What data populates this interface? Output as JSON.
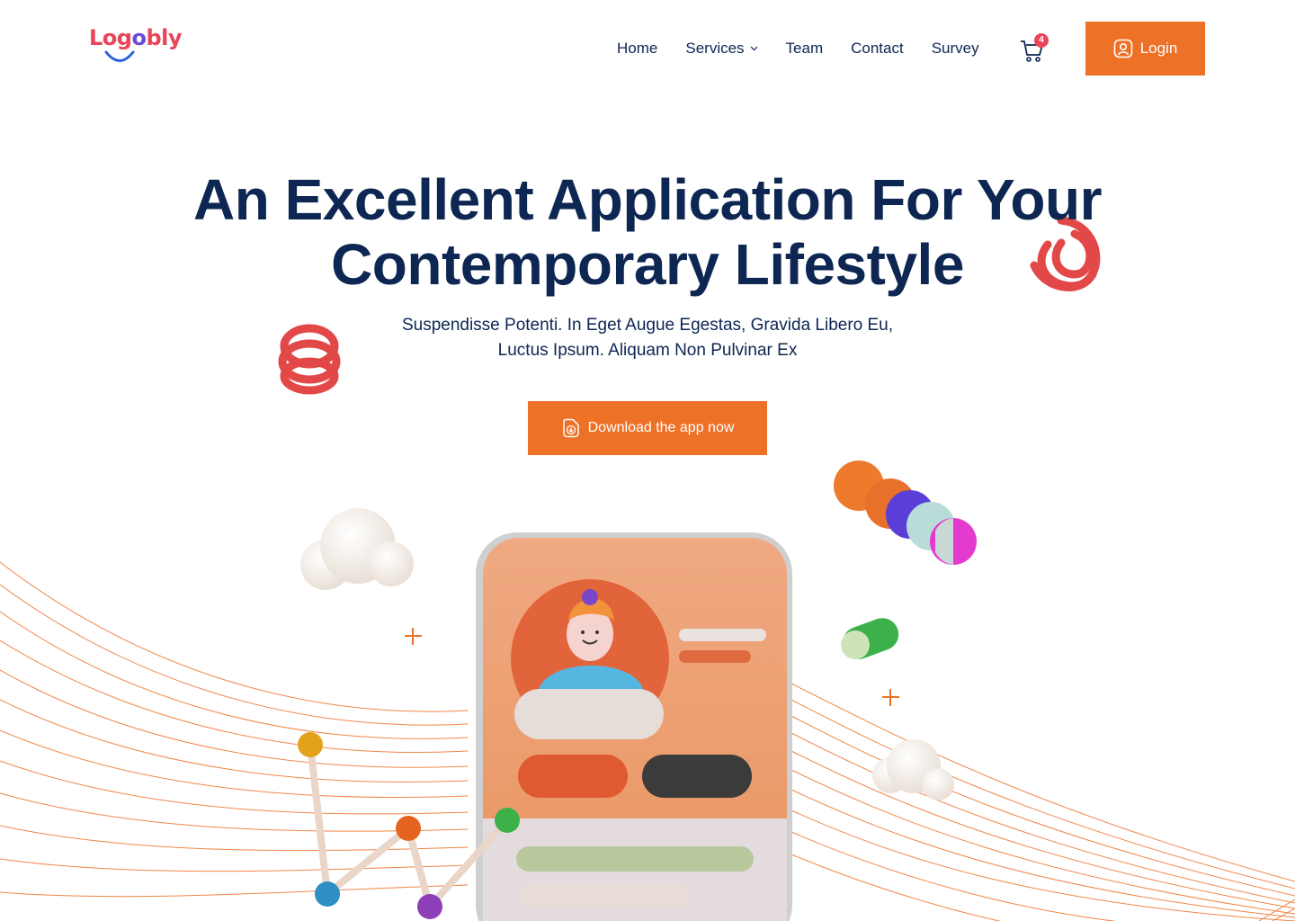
{
  "brand": {
    "logo_text_a": "Log",
    "logo_text_b": "o",
    "logo_text_c": "bly"
  },
  "nav": {
    "items": [
      {
        "label": "Home"
      },
      {
        "label": "Services"
      },
      {
        "label": "Team"
      },
      {
        "label": "Contact"
      },
      {
        "label": "Survey"
      }
    ],
    "cart_count": "4",
    "login_label": "Login"
  },
  "hero": {
    "title_line1": "An Excellent Application For Your",
    "title_line2": "Contemporary Lifestyle",
    "subtitle_line1": "Suspendisse Potenti. In Eget Augue Egestas, Gravida Libero Eu,",
    "subtitle_line2": "Luctus Ipsum. Aliquam Non Pulvinar Ex",
    "cta_label": "Download the app now"
  },
  "colors": {
    "accent": "#ee7128",
    "navy": "#0d2652",
    "logo_red": "#e8445a",
    "logo_purple": "#6c4bd6"
  },
  "icons": [
    "chevron-down-icon",
    "cart-icon",
    "user-icon",
    "download-icon"
  ]
}
